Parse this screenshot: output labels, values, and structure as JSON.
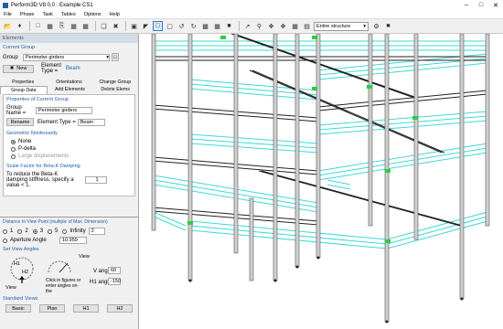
{
  "window": {
    "title": "Perform3D V8.0.0 : Example CS1"
  },
  "menu": [
    "File",
    "Phase",
    "Task",
    "Tables",
    "Options",
    "Help"
  ],
  "toolbar": {
    "structure_select": "Entire structure"
  },
  "panel": {
    "header": "Elements",
    "current_group_title": "Current Group",
    "group_label": "Group",
    "group_value": "Perimeter girders",
    "new_button": "New",
    "element_type_label": "Element Type =",
    "element_type_value": "Beam",
    "tabs_row1": [
      "Properties",
      "Orientations",
      "Change Group"
    ],
    "tabs_row2": [
      "Group Data",
      "Add Elements",
      "Delete Elems"
    ],
    "props_title": "Properties of Current Group",
    "group_name_label": "Group Name =",
    "group_name_value": "Perimeter girders",
    "rename_button": "Rename",
    "elem_type2_label": "Element Type =",
    "elem_type2_value": "Beam",
    "geom_title": "Geometric Nonlinearity",
    "geom_options": [
      "None",
      "P-delta",
      "Large displacements"
    ],
    "scale_title": "Scale Factor for Beta-K Damping",
    "scale_text": "To reduce the Beta-K damping stiffness, specify a value < 1.",
    "scale_value": "1",
    "distance_title": "Distance to View Point (multiple of Max. Dimension)",
    "distance_options": [
      "1",
      "2",
      "3",
      "5",
      "Infinity"
    ],
    "distance_value": "2",
    "aperture_label": "Aperture Angle",
    "aperture_value": "10.959",
    "set_view_title": "Set View Angles",
    "h1": "H1",
    "h2": "H2",
    "view_label1": "View",
    "view_label2": "View",
    "click_text": "Click in figures or enter angles on the",
    "v_angle_label": "V angle",
    "v_angle_value": "60",
    "h1_angle_label": "H1 angle",
    "h1_angle_value": "-150",
    "standard_views_title": "Standard Views",
    "std_views": [
      "Basic",
      "Plan",
      "H1",
      "H2"
    ]
  }
}
